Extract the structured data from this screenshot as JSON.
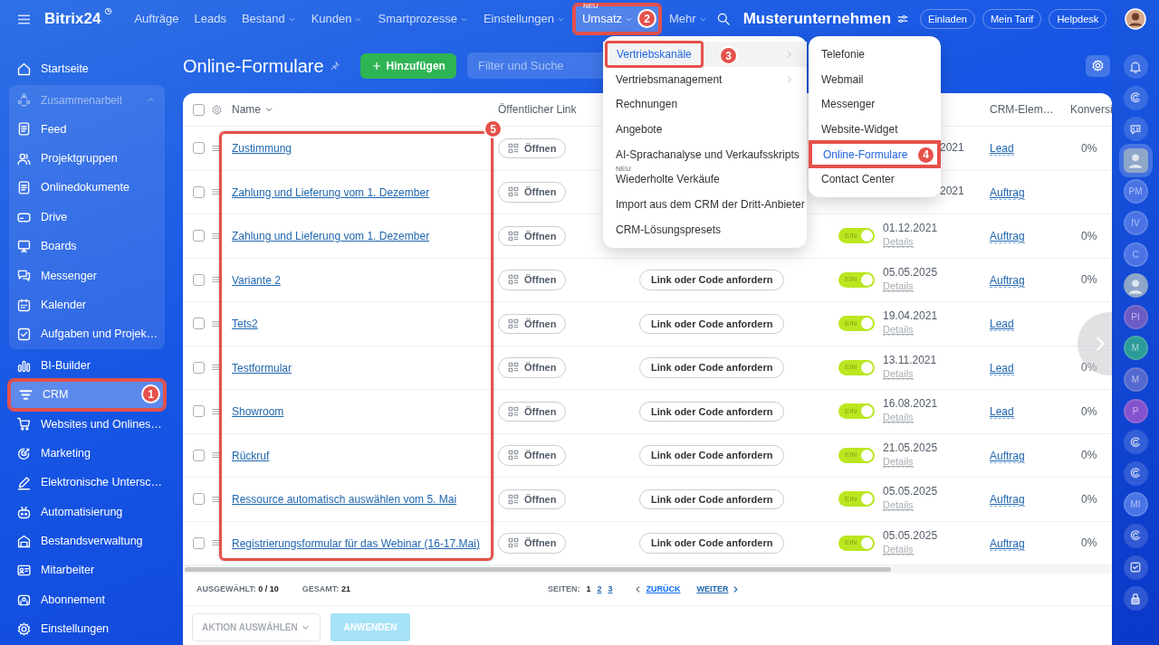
{
  "app": {
    "logo": "Bitrix24"
  },
  "sidebar": {
    "items": [
      {
        "label": "Startseite",
        "selected": false
      },
      {
        "kind": "group",
        "label": "Zusammenarbeit",
        "expanded": true,
        "children": [
          {
            "label": "Feed",
            "selected": false
          },
          {
            "label": "Projektgruppen",
            "selected": false
          },
          {
            "label": "Onlinedokumente",
            "selected": false
          },
          {
            "label": "Drive",
            "selected": false
          },
          {
            "label": "Boards",
            "selected": false
          },
          {
            "label": "Messenger",
            "selected": false
          },
          {
            "label": "Kalender",
            "selected": false
          },
          {
            "label": "Aufgaben und Projek…",
            "selected": false
          }
        ]
      },
      {
        "label": "BI-Builder",
        "selected": false
      },
      {
        "label": "CRM",
        "selected": true,
        "callout": "1"
      },
      {
        "label": "Websites und Onlines…",
        "selected": false
      },
      {
        "label": "Marketing",
        "selected": false
      },
      {
        "label": "Elektronische Untersc…",
        "selected": false
      },
      {
        "label": "Automatisierung",
        "selected": false
      },
      {
        "label": "Bestandsverwaltung",
        "selected": false
      },
      {
        "label": "Mitarbeiter",
        "selected": false
      },
      {
        "label": "Abonnement",
        "selected": false
      },
      {
        "label": "Einstellungen",
        "selected": false
      }
    ]
  },
  "top_nav": {
    "items": [
      {
        "label": "Aufträge",
        "dropdown": false,
        "selected": false
      },
      {
        "label": "Leads",
        "dropdown": false,
        "selected": false
      },
      {
        "label": "Bestand",
        "dropdown": true,
        "selected": false
      },
      {
        "label": "Kunden",
        "dropdown": true,
        "selected": false
      },
      {
        "label": "Smartprozesse",
        "dropdown": true,
        "selected": false
      },
      {
        "label": "Einstellungen",
        "dropdown": true,
        "selected": false
      },
      {
        "label": "Umsatz",
        "badge": "NEU",
        "dropdown": true,
        "selected": true,
        "callout": "2"
      },
      {
        "label": "Mehr",
        "dropdown": true,
        "selected": false
      }
    ]
  },
  "header_right": {
    "company": "Musterunternehmen",
    "buttons": [
      "Einladen",
      "Mein Tarif",
      "Helpdesk"
    ]
  },
  "page": {
    "title": "Online-Formulare",
    "add_button": "Hinzufügen",
    "search": {
      "placeholder": "Filter und Suche"
    }
  },
  "table": {
    "select_all": {
      "checked": false
    },
    "columns": [
      {
        "label": "Name",
        "dropdown": true
      },
      {
        "label": "Öffentlicher Link"
      },
      {
        "label": "CRM-Elem…"
      },
      {
        "label": "Konversi"
      }
    ],
    "name_callout": "5",
    "rows": [
      {
        "checked": false,
        "name": "Zustimmung",
        "link": "Öffnen",
        "date": "2021",
        "crm": "Lead",
        "conversion": "0%"
      },
      {
        "checked": false,
        "name": "Zahlung und Lieferung vom 1. Dezember",
        "link": "Öffnen",
        "date": "2021",
        "crm": "Auftrag"
      },
      {
        "checked": false,
        "name": "Zahlung und Lieferung vom 1. Dezember",
        "link": "Öffnen",
        "toggle": {
          "label": "EIN",
          "on": true
        },
        "date": "01.12.2021",
        "details": "Details",
        "crm": "Auftrag",
        "conversion": "0%"
      },
      {
        "checked": false,
        "name": "Variante 2",
        "link": "Öffnen",
        "code": "Link oder Code anfordern",
        "toggle": {
          "label": "EIN",
          "on": true
        },
        "date": "05.05.2025",
        "details": "Details",
        "crm": "Auftrag",
        "conversion": "0%"
      },
      {
        "checked": false,
        "name": "Tets2",
        "link": "Öffnen",
        "code": "Link oder Code anfordern",
        "toggle": {
          "label": "EIN",
          "on": true
        },
        "date": "19.04.2021",
        "details": "Details",
        "crm": "Lead"
      },
      {
        "checked": false,
        "name": "Testformular",
        "link": "Öffnen",
        "code": "Link oder Code anfordern",
        "toggle": {
          "label": "EIN",
          "on": true
        },
        "date": "13.11.2021",
        "details": "Details",
        "crm": "Lead",
        "conversion": "0%"
      },
      {
        "checked": false,
        "name": "Showroom",
        "link": "Öffnen",
        "code": "Link oder Code anfordern",
        "toggle": {
          "label": "EIN",
          "on": true
        },
        "date": "16.08.2021",
        "details": "Details",
        "crm": "Lead",
        "conversion": "0%"
      },
      {
        "checked": false,
        "name": "Rückruf",
        "link": "Öffnen",
        "code": "Link oder Code anfordern",
        "toggle": {
          "label": "EIN",
          "on": true
        },
        "date": "21.05.2025",
        "details": "Details",
        "crm": "Auftrag",
        "conversion": "0%"
      },
      {
        "checked": false,
        "name": "Ressource automatisch auswählen vom 5. Mai",
        "link": "Öffnen",
        "code": "Link oder Code anfordern",
        "toggle": {
          "label": "EIN",
          "on": true
        },
        "date": "05.05.2025",
        "details": "Details",
        "crm": "Auftrag",
        "conversion": "0%"
      },
      {
        "checked": false,
        "name": "Registrierungsformular für das Webinar (16-17.Mai)",
        "link": "Öffnen",
        "code": "Link oder Code anfordern",
        "toggle": {
          "label": "EIN",
          "on": true
        },
        "date": "05.05.2025",
        "details": "Details",
        "crm": "Auftrag",
        "conversion": "0%"
      }
    ]
  },
  "footer": {
    "selected_label": "AUSGEWÄHLT:",
    "selected": "0 / 10",
    "total_label": "GESAMT:",
    "total": "21",
    "pages_label": "SEITEN:",
    "pages": [
      {
        "label": "1",
        "selected": true
      },
      {
        "label": "2",
        "selected": false
      },
      {
        "label": "3",
        "selected": false
      }
    ],
    "prev": "ZURÜCK",
    "next": "WEITER",
    "action": {
      "placeholder": "AKTION AUSWÄHLEN"
    },
    "apply": {
      "label": "ANWENDEN",
      "disabled": true
    }
  },
  "menu": {
    "items": [
      {
        "label": "Vertriebskanäle",
        "selected": true,
        "submenu": true,
        "callout": "3"
      },
      {
        "label": "Vertriebsmanagement",
        "selected": false,
        "submenu": true
      },
      {
        "label": "Rechnungen",
        "selected": false,
        "submenu": false
      },
      {
        "label": "Angebote",
        "selected": false,
        "submenu": false
      },
      {
        "label": "AI-Sprachanalyse und Verkaufsskripts",
        "selected": false,
        "submenu": false
      },
      {
        "label": "Wiederholte Verkäufe",
        "badge": "NEU",
        "selected": false,
        "submenu": false
      },
      {
        "label": "Import aus dem CRM der Dritt-Anbieter",
        "selected": false,
        "submenu": false
      },
      {
        "label": "CRM-Lösungspresets",
        "selected": false,
        "submenu": false
      }
    ]
  },
  "submenu": {
    "items": [
      {
        "label": "Telefonie",
        "selected": false
      },
      {
        "label": "Webmail",
        "selected": false
      },
      {
        "label": "Messenger",
        "selected": false
      },
      {
        "label": "Website-Widget",
        "selected": false
      },
      {
        "label": "Online-Formulare",
        "selected": true,
        "callout": "4"
      },
      {
        "label": "Contact Center",
        "selected": false
      }
    ]
  },
  "right_bar": {
    "items": [
      {
        "kind": "bell"
      },
      {
        "kind": "assistant"
      },
      {
        "kind": "chat"
      },
      {
        "kind": "user",
        "selected": true
      },
      {
        "kind": "initials",
        "label": "PM",
        "color": "#4a74e6"
      },
      {
        "kind": "initials",
        "label": "IV",
        "color": "#4a74e6"
      },
      {
        "kind": "initials",
        "label": "C",
        "color": "#4a74e6"
      },
      {
        "kind": "user",
        "selected": false
      },
      {
        "kind": "initials",
        "label": "PI",
        "color": "#6a5cc4"
      },
      {
        "kind": "initials",
        "label": "M",
        "color": "#2c9c9a"
      },
      {
        "kind": "initials",
        "label": "M",
        "color": "#5468d0"
      },
      {
        "kind": "initials",
        "label": "P",
        "color": "#8552cf"
      },
      {
        "kind": "assistant"
      },
      {
        "kind": "assistant"
      },
      {
        "kind": "initials",
        "label": "MI",
        "color": "#4a74e6"
      },
      {
        "kind": "assistant"
      },
      {
        "kind": "tasks"
      },
      {
        "kind": "lock"
      }
    ]
  }
}
